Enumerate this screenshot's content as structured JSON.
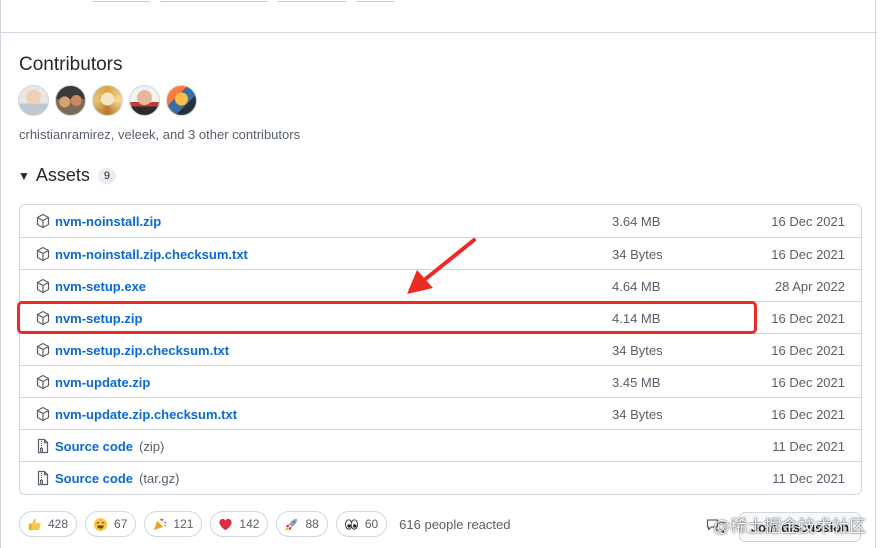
{
  "contributors": {
    "title": "Contributors",
    "summary": "crhistianramirez, veleek, and 3 other contributors"
  },
  "assets": {
    "title": "Assets",
    "count": "9",
    "items": [
      {
        "name": "nvm-noinstall.zip",
        "size": "3.64 MB",
        "date": "16 Dec 2021",
        "icon": "package-icon"
      },
      {
        "name": "nvm-noinstall.zip.checksum.txt",
        "size": "34 Bytes",
        "date": "16 Dec 2021",
        "icon": "package-icon"
      },
      {
        "name": "nvm-setup.exe",
        "size": "4.64 MB",
        "date": "28 Apr 2022",
        "icon": "package-icon"
      },
      {
        "name": "nvm-setup.zip",
        "size": "4.14 MB",
        "date": "16 Dec 2021",
        "icon": "package-icon"
      },
      {
        "name": "nvm-setup.zip.checksum.txt",
        "size": "34 Bytes",
        "date": "16 Dec 2021",
        "icon": "package-icon"
      },
      {
        "name": "nvm-update.zip",
        "size": "3.45 MB",
        "date": "16 Dec 2021",
        "icon": "package-icon"
      },
      {
        "name": "nvm-update.zip.checksum.txt",
        "size": "34 Bytes",
        "date": "16 Dec 2021",
        "icon": "package-icon"
      },
      {
        "name": "Source code",
        "ext": "(zip)",
        "size": "",
        "date": "11 Dec 2021",
        "icon": "file-zip-icon"
      },
      {
        "name": "Source code",
        "ext": "(tar.gz)",
        "size": "",
        "date": "11 Dec 2021",
        "icon": "file-zip-icon"
      }
    ]
  },
  "reactions": {
    "items": [
      {
        "emoji": "thumbs-up-icon",
        "count": "428"
      },
      {
        "emoji": "laugh-icon",
        "count": "67"
      },
      {
        "emoji": "hooray-icon",
        "count": "121"
      },
      {
        "emoji": "heart-icon",
        "count": "142"
      },
      {
        "emoji": "rocket-icon",
        "count": "88"
      },
      {
        "emoji": "eyes-icon",
        "count": "60"
      }
    ],
    "summary": "616 people reacted"
  },
  "discussion": {
    "button_label": "Join discussion"
  },
  "watermark": {
    "text": "@稀土掘金技术社区"
  },
  "colors": {
    "link": "#0969da",
    "highlight": "#ec2b25",
    "muted": "#57606a",
    "border": "#d0d7de"
  }
}
